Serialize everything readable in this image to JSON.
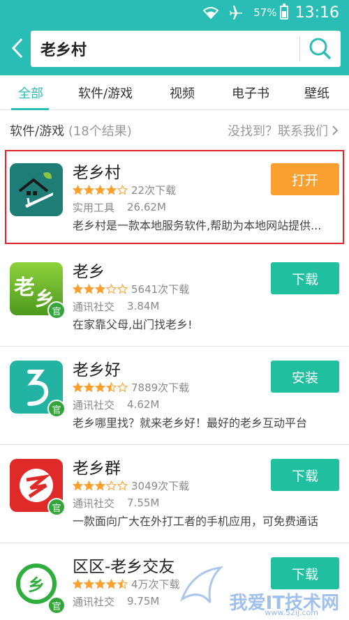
{
  "status_bar": {
    "battery": "57%",
    "time": "13:16",
    "battery_level": 0.57
  },
  "search": {
    "query": "老乡村"
  },
  "tabs": [
    {
      "label": "全部",
      "active": true
    },
    {
      "label": "软件/游戏",
      "active": false
    },
    {
      "label": "视频",
      "active": false
    },
    {
      "label": "电子书",
      "active": false
    },
    {
      "label": "壁纸",
      "active": false
    }
  ],
  "section": {
    "title": "软件/游戏",
    "count": "(18个结果)",
    "feedback": "没找到？联系我们"
  },
  "apps": [
    {
      "name": "老乡村",
      "rating": 4,
      "downloads": "22次下载",
      "category": "实用工具",
      "size": "26.62M",
      "description": "老乡村是一款本地服务软件,帮助为本地网站提供...",
      "button": "打开",
      "button_color": "#f9a030",
      "official": false,
      "icon": "house-leaf-icon"
    },
    {
      "name": "老乡",
      "rating": 3,
      "downloads": "5641次下载",
      "category": "通讯社交",
      "size": "3.84M",
      "description": "在家靠父母,出门找老乡!",
      "button": "下载",
      "button_color": "#1fbfa0",
      "official": true,
      "badge": "官",
      "icon": "laoxiang-text-icon"
    },
    {
      "name": "老乡好",
      "rating": 3.5,
      "downloads": "7889次下载",
      "category": "通讯社交",
      "size": "4.62M",
      "description": "老乡哪里找？就来老乡好！最好的老乡互动平台",
      "button": "安装",
      "button_color": "#1fbfa0",
      "official": true,
      "badge": "官",
      "icon": "xiang-swirl-icon"
    },
    {
      "name": "老乡群",
      "rating": 3,
      "downloads": "3049次下载",
      "category": "通讯社交",
      "size": "7.55M",
      "description": "一款面向广大在外打工者的手机应用，可免费通话",
      "button": "下载",
      "button_color": "#1fbfa0",
      "official": true,
      "badge": "官",
      "icon": "red-circle-icon"
    },
    {
      "name": "区区-老乡交友",
      "rating": 4.5,
      "downloads": "4万次下载",
      "category": "通讯社交",
      "size": "9.75M",
      "description": "",
      "button": "下载",
      "button_color": "#1fbfa0",
      "official": true,
      "badge": "官",
      "icon": "green-ring-icon"
    }
  ],
  "watermark": {
    "text": "我爱IT技术网",
    "url": "www.52ij.com"
  },
  "colors": {
    "accent": "#2abdb6",
    "orange": "#f9a030",
    "highlight_border": "#e0242d"
  }
}
